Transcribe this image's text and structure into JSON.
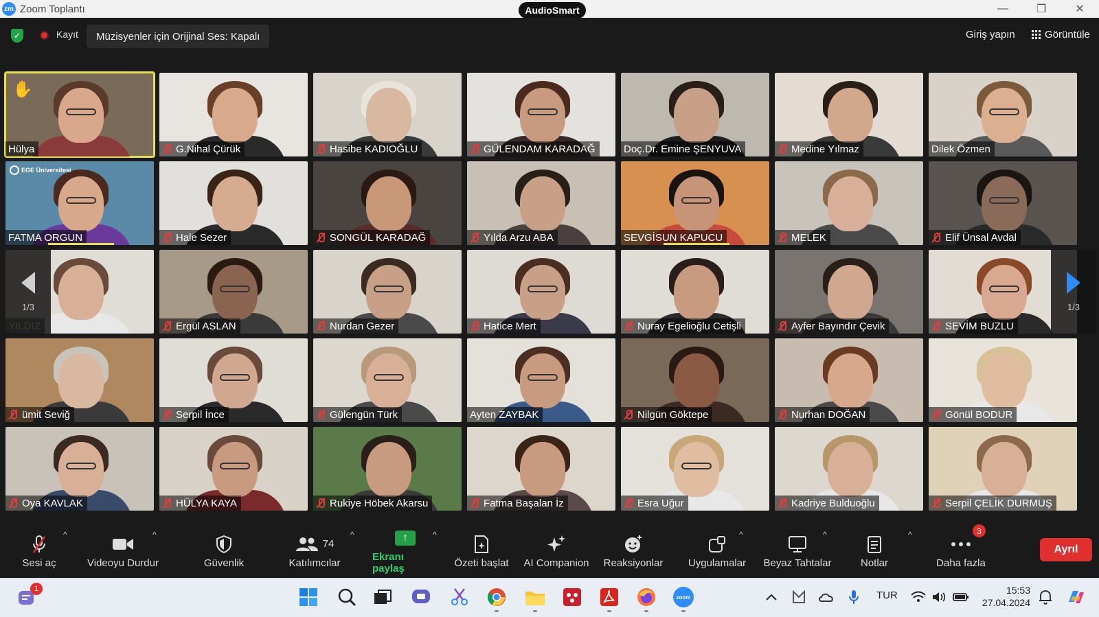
{
  "window": {
    "title": "Zoom Toplantı",
    "logo_text": "zm",
    "plugin_badge": "AudioSmart",
    "minimize_glyph": "—",
    "maximize_glyph": "❐",
    "close_glyph": "✕"
  },
  "meeting_bar": {
    "recording_label": "Kayıt",
    "original_sound": "Müzisyenler için Orijinal Ses: Kapalı",
    "sign_in": "Giriş yapın",
    "view": "Görüntüle"
  },
  "gallery": {
    "page_indicator_left": "1/3",
    "page_indicator_right": "1/3",
    "ege_logo_text": "EGE Üniversitesi",
    "participants": [
      {
        "name": "Hülya",
        "muted": false,
        "bg": "#7a6a5a",
        "skin": "#d9a88a",
        "hair": "#5a3b2a",
        "shirt": "#8a3a3a",
        "glasses": true,
        "hand_raised": true,
        "active": true
      },
      {
        "name": "G.Nihal Çürük",
        "muted": true,
        "bg": "#e8e4e0",
        "skin": "#d9a98c",
        "hair": "#6a3f2a",
        "shirt": "#2a2a2a",
        "glasses": false
      },
      {
        "name": "Hasibe KADIOĞLU",
        "muted": true,
        "bg": "#d8d4cc",
        "skin": "#d8b8a0",
        "hair": "#e8e4dc",
        "shirt": "#3a3a3a",
        "glasses": false
      },
      {
        "name": "GÜLENDAM KARADAĞ",
        "muted": true,
        "bg": "#e4e2de",
        "skin": "#c89a80",
        "hair": "#4a2a1e",
        "shirt": "#3a2a2a",
        "glasses": true
      },
      {
        "name": "Doç.Dr. Emine ŞENYUVA",
        "muted": false,
        "bg": "#bdb8b0",
        "skin": "#c8a088",
        "hair": "#2a1e18",
        "shirt": "#1e1e1e",
        "glasses": false
      },
      {
        "name": "Medine Yılmaz",
        "muted": true,
        "bg": "#e4dcd2",
        "skin": "#d2a88c",
        "hair": "#2a1e18",
        "shirt": "#3a3a3a",
        "glasses": false
      },
      {
        "name": "Dilek Özmen",
        "muted": false,
        "bg": "#d8d2c8",
        "skin": "#dab090",
        "hair": "#7a5a3a",
        "shirt": "#5a5a5a",
        "glasses": true
      },
      {
        "name": "FATMA ORGUN",
        "muted": false,
        "bg": "#5a8aa8",
        "skin": "#d8a88a",
        "hair": "#4a2a1e",
        "shirt": "#6a3a9a",
        "glasses": true,
        "ege_logo": true,
        "speaking": true
      },
      {
        "name": "Hale Sezer",
        "muted": true,
        "bg": "#e2e0dc",
        "skin": "#d6ac90",
        "hair": "#3a2418",
        "shirt": "#2a2a2a",
        "glasses": false
      },
      {
        "name": "SONGÜL KARADAĞ",
        "muted": true,
        "bg": "#4a4440",
        "skin": "#c89878",
        "hair": "#2a1a12",
        "shirt": "#5a2a2a",
        "glasses": false
      },
      {
        "name": "Yılda Arzu ABA",
        "muted": true,
        "bg": "#c8c0b4",
        "skin": "#c8a088",
        "hair": "#2a1e18",
        "shirt": "#4a4040",
        "glasses": false
      },
      {
        "name": "SEVGİSUN KAPUCU",
        "muted": false,
        "bg": "#d89050",
        "skin": "#c89478",
        "hair": "#1a1410",
        "shirt": "#c84a3a",
        "glasses": true,
        "speaking": true
      },
      {
        "name": "MELEK",
        "muted": true,
        "bg": "#c8c4bc",
        "skin": "#d8b09a",
        "hair": "#8a6a4a",
        "shirt": "#4a4a4a",
        "glasses": false
      },
      {
        "name": "Elif Ünsal Avdal",
        "muted": true,
        "bg": "#5a5450",
        "skin": "#8a6a58",
        "hair": "#1a1412",
        "shirt": "#2a2a2a",
        "glasses": true
      },
      {
        "name": "YILDIZ",
        "muted": false,
        "bg": "#e0dcd6",
        "skin": "#d8b098",
        "hair": "#6a4a3a",
        "shirt": "#e8e8e8",
        "glasses": false
      },
      {
        "name": "Ergül ASLAN",
        "muted": true,
        "bg": "#a89a88",
        "skin": "#8a6450",
        "hair": "#2a1a12",
        "shirt": "#3a3a3a",
        "glasses": true
      },
      {
        "name": "Nurdan Gezer",
        "muted": true,
        "bg": "#d8d4cc",
        "skin": "#c8a088",
        "hair": "#3a2a22",
        "shirt": "#4a4a4a",
        "glasses": true
      },
      {
        "name": "Hatice Mert",
        "muted": true,
        "bg": "#dedad4",
        "skin": "#c8a088",
        "hair": "#4a2e22",
        "shirt": "#3a3a4a",
        "glasses": true
      },
      {
        "name": "Nuray Egelioğlu Cetişli",
        "muted": true,
        "bg": "#e0dcd6",
        "skin": "#c89a80",
        "hair": "#2a1e18",
        "shirt": "#2a2a2a",
        "glasses": false
      },
      {
        "name": "Ayfer Bayındır Çevik",
        "muted": true,
        "bg": "#7a7470",
        "skin": "#d0a890",
        "hair": "#2a1e18",
        "shirt": "#3a3a3a",
        "glasses": false
      },
      {
        "name": "SEVİM BUZLU",
        "muted": true,
        "bg": "#e2dcd4",
        "skin": "#d8a890",
        "hair": "#8a4a2a",
        "shirt": "#2a2a2a",
        "glasses": true
      },
      {
        "name": "ümit Seviğ",
        "muted": true,
        "bg": "#b08860",
        "skin": "#d8b8a0",
        "hair": "#c8c4bc",
        "shirt": "#3a3a3a",
        "glasses": false
      },
      {
        "name": "Serpil İnce",
        "muted": true,
        "bg": "#e0dcd6",
        "skin": "#d0a890",
        "hair": "#6a4a3a",
        "shirt": "#2a2a2a",
        "glasses": true
      },
      {
        "name": "Gülengün Türk",
        "muted": true,
        "bg": "#dcd8d0",
        "skin": "#d8b098",
        "hair": "#b89a7a",
        "shirt": "#4a4a4a",
        "glasses": true
      },
      {
        "name": "Ayten ZAYBAK",
        "muted": false,
        "bg": "#e4e0da",
        "skin": "#c89a80",
        "hair": "#4a2e22",
        "shirt": "#3a5a8a",
        "glasses": true
      },
      {
        "name": "Nilgün Göktepe",
        "muted": true,
        "bg": "#7a6858",
        "skin": "#8a5a44",
        "hair": "#2a1a12",
        "shirt": "#3a2a22",
        "glasses": false
      },
      {
        "name": "Nurhan DOĞAN",
        "muted": true,
        "bg": "#c8bcb0",
        "skin": "#d8a88c",
        "hair": "#6a3a22",
        "shirt": "#4a4a4a",
        "glasses": false
      },
      {
        "name": "Gönül BODUR",
        "muted": true,
        "bg": "#e8e4dc",
        "skin": "#e0bca0",
        "hair": "#d8c098",
        "shirt": "#e8e8e8",
        "glasses": false
      },
      {
        "name": "Oya KAVLAK",
        "muted": true,
        "bg": "#c8c2b8",
        "skin": "#d8b098",
        "hair": "#3a2a22",
        "shirt": "#3a4a6a",
        "glasses": true
      },
      {
        "name": "HÜLYA KAYA",
        "muted": true,
        "bg": "#d8d2c8",
        "skin": "#c89a80",
        "hair": "#6a4a3a",
        "shirt": "#7a2a2a",
        "glasses": true
      },
      {
        "name": "Rukiye Höbek Akarsu",
        "muted": true,
        "bg": "#5a7a4a",
        "skin": "#c89a80",
        "hair": "#2a1e18",
        "shirt": "#3a3a3a",
        "glasses": false
      },
      {
        "name": "Fatma Başalan İz",
        "muted": true,
        "bg": "#ddd6cc",
        "skin": "#c89a80",
        "hair": "#3a2418",
        "shirt": "#5a4a4a",
        "glasses": false
      },
      {
        "name": "Esra Uğur",
        "muted": true,
        "bg": "#e4e0da",
        "skin": "#e0bca0",
        "hair": "#c8a878",
        "shirt": "#e8e8e8",
        "glasses": true
      },
      {
        "name": "Kadriye Bulduoğlu",
        "muted": true,
        "bg": "#dcd8d0",
        "skin": "#d8b098",
        "hair": "#b8986a",
        "shirt": "#e8e8e8",
        "glasses": false
      },
      {
        "name": "Serpil ÇELİK DURMUŞ",
        "muted": true,
        "bg": "#e0d2b8",
        "skin": "#d8b098",
        "hair": "#8a6a4a",
        "shirt": "#e8e8e8",
        "glasses": false
      }
    ]
  },
  "toolbar": {
    "unmute": "Sesi aç",
    "stop_video": "Videoyu Durdur",
    "security": "Güvenlik",
    "participants": "Katılımcılar",
    "participants_count": "74",
    "share_screen": "Ekranı paylaş",
    "summary": "Özeti başlat",
    "ai_companion": "AI Companion",
    "reactions": "Reaksiyonlar",
    "apps": "Uygulamalar",
    "whiteboards": "Beyaz Tahtalar",
    "notes": "Notlar",
    "more": "Daha fazla",
    "more_badge": "3",
    "leave": "Ayrıl",
    "caret_glyph": "^"
  },
  "taskbar": {
    "teams_badge": "1",
    "language": "TUR",
    "time": "15:53",
    "date": "27.04.2024"
  },
  "colors": {
    "zoom_blue": "#2d8cff",
    "share_green": "#24a148",
    "leave_red": "#e02f2f",
    "speaker_yellow": "#e8e04a"
  }
}
